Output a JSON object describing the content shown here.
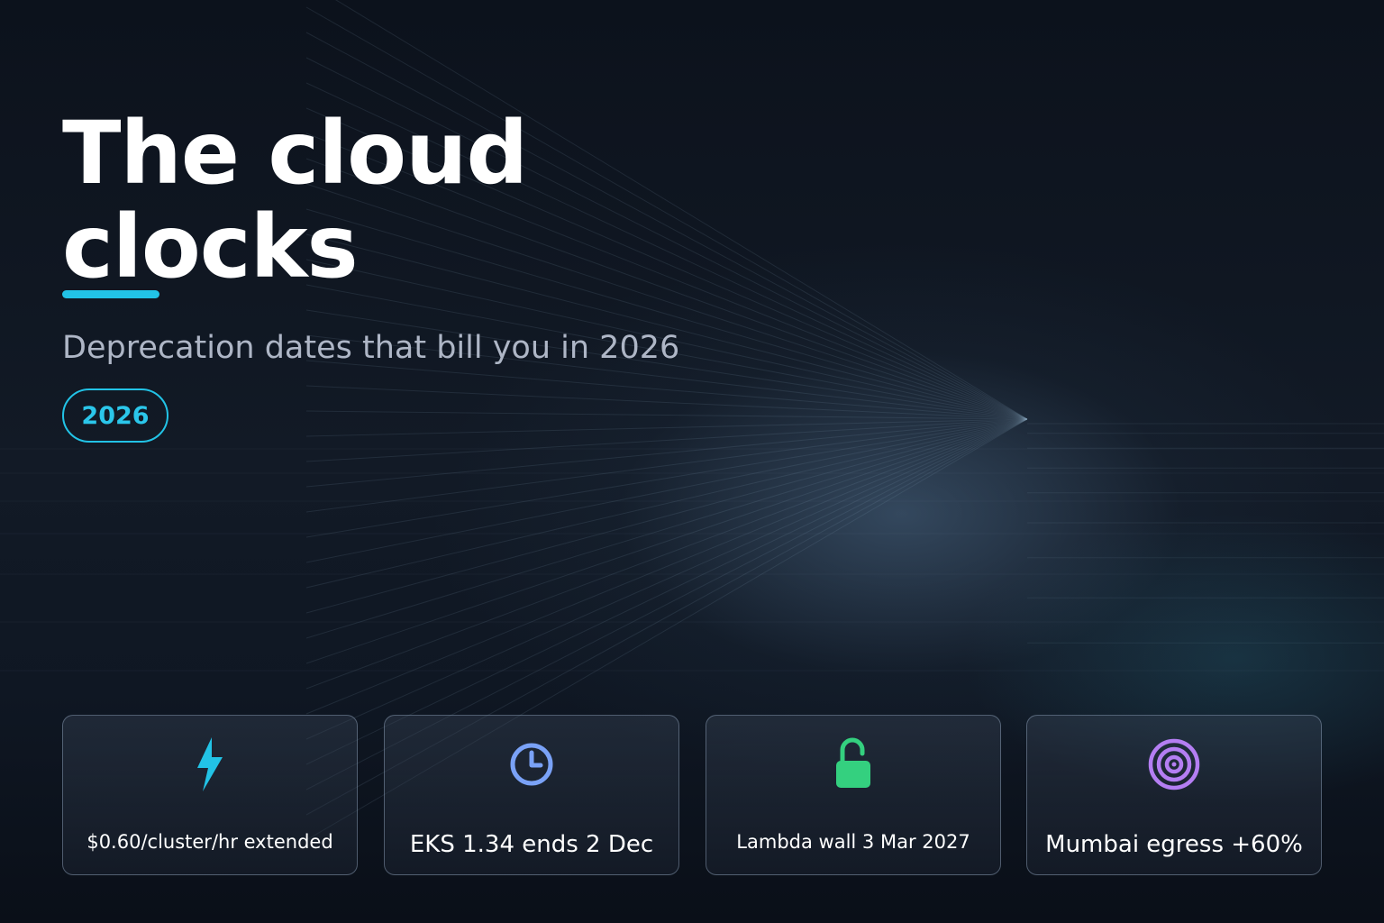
{
  "hero": {
    "title_line1": "The cloud",
    "title_line2": "clocks",
    "subtitle": "Deprecation dates that bill you in 2026",
    "year_badge": "2026"
  },
  "cards": [
    {
      "label": "$0.60/cluster/hr extended",
      "icon": "lightning-bolt-icon",
      "color": "#22c3e6"
    },
    {
      "label": "EKS 1.34 ends 2 Dec",
      "icon": "clock-icon",
      "color": "#7aa2f7"
    },
    {
      "label": "Lambda wall 3 Mar 2027",
      "icon": "unlocked-padlock-icon",
      "color": "#34d07f"
    },
    {
      "label": "Mumbai egress +60%",
      "icon": "target-icon",
      "color": "#b47ef2"
    }
  ],
  "colors": {
    "accent": "#22c3e6",
    "background": "#0b111b"
  }
}
